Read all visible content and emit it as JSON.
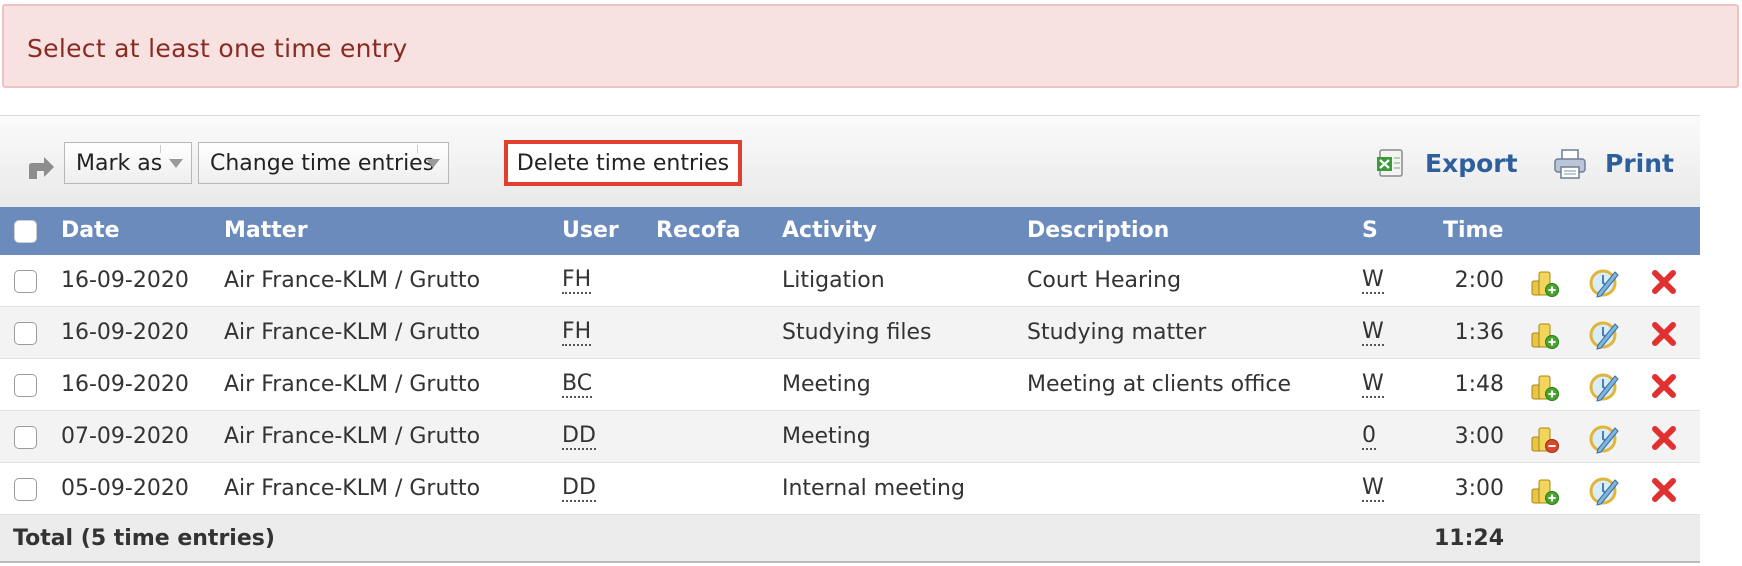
{
  "alert": {
    "message": "Select at least one time entry"
  },
  "toolbar": {
    "mark_as": "Mark as",
    "change_time_entries": "Change time entries",
    "delete_time_entries": "Delete time entries",
    "export": "Export",
    "print": "Print"
  },
  "table": {
    "headers": {
      "date": "Date",
      "matter": "Matter",
      "user": "User",
      "recofa": "Recofa",
      "activity": "Activity",
      "description": "Description",
      "status": "S",
      "time": "Time"
    },
    "rows": [
      {
        "date": "16-09-2020",
        "matter": "Air France-KLM / Grutto",
        "user": "FH",
        "recofa": "",
        "activity": "Litigation",
        "description": "Court Hearing",
        "status": "W",
        "time": "2:00",
        "billing_icon": "coins-add-icon"
      },
      {
        "date": "16-09-2020",
        "matter": "Air France-KLM / Grutto",
        "user": "FH",
        "recofa": "",
        "activity": "Studying files",
        "description": "Studying matter",
        "status": "W",
        "time": "1:36",
        "billing_icon": "coins-add-icon"
      },
      {
        "date": "16-09-2020",
        "matter": "Air France-KLM / Grutto",
        "user": "BC",
        "recofa": "",
        "activity": "Meeting",
        "description": "Meeting at clients office",
        "status": "W",
        "time": "1:48",
        "billing_icon": "coins-add-icon"
      },
      {
        "date": "07-09-2020",
        "matter": "Air France-KLM / Grutto",
        "user": "DD",
        "recofa": "",
        "activity": "Meeting",
        "description": "",
        "status": "0",
        "time": "3:00",
        "billing_icon": "coins-remove-icon"
      },
      {
        "date": "05-09-2020",
        "matter": "Air France-KLM / Grutto",
        "user": "DD",
        "recofa": "",
        "activity": "Internal meeting",
        "description": "",
        "status": "W",
        "time": "3:00",
        "billing_icon": "coins-add-icon"
      }
    ],
    "total": {
      "label": "Total (5 time entries)",
      "value": "11:24"
    }
  },
  "colors": {
    "alert_bg": "#f7e1e1",
    "alert_text": "#8a2b22",
    "header_bg": "#6b8bbd",
    "link": "#2d5f9d",
    "highlight": "#e0402d",
    "delete_icon": "#e03030"
  }
}
